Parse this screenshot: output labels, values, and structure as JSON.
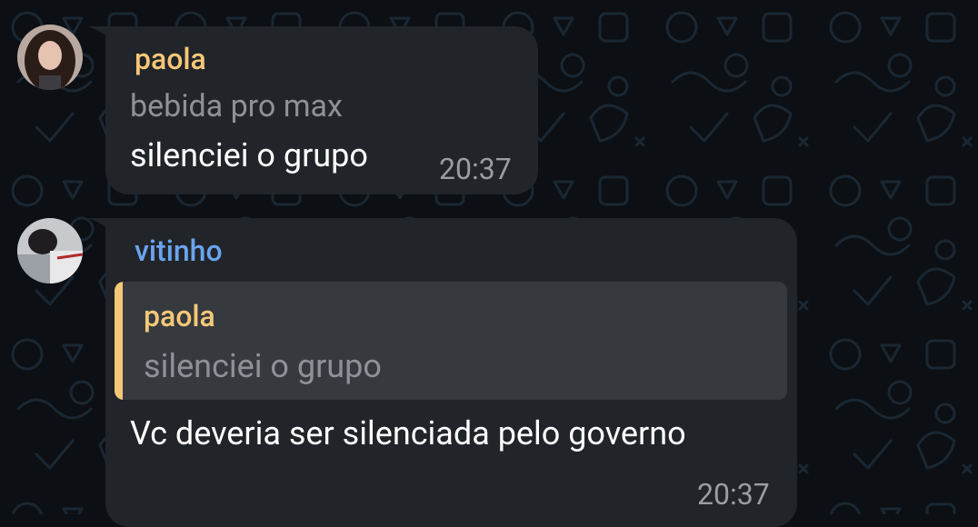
{
  "colors": {
    "background": "#0c0f13",
    "bubble": "#212429",
    "reply_box": "#363a3f",
    "paola_name": "#f5c877",
    "vitinho_name": "#6aa4ef",
    "message_text": "#ffffff",
    "muted_text": "#8e9196"
  },
  "messages": [
    {
      "sender": "paola",
      "subtitle": "bebida pro max",
      "text": "silenciei o grupo",
      "time": "20:37",
      "avatar_icon": "user-avatar-photo"
    },
    {
      "sender": "vitinho",
      "reply": {
        "sender": "paola",
        "text": "silenciei o grupo"
      },
      "text": "Vc deveria ser silenciada pelo governo",
      "time": "20:37",
      "avatar_icon": "user-avatar-photo"
    }
  ]
}
